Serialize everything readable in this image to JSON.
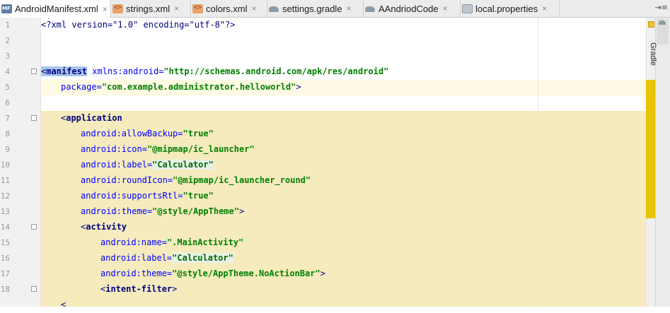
{
  "tabs": [
    {
      "label": "AndroidManifest.xml",
      "icon": "manifest-file-icon",
      "active": true
    },
    {
      "label": "strings.xml",
      "icon": "xml-file-icon"
    },
    {
      "label": "colors.xml",
      "icon": "xml-file-icon"
    },
    {
      "label": "settings.gradle",
      "icon": "gradle-icon"
    },
    {
      "label": "AAndriodCode",
      "icon": "gradle-icon"
    },
    {
      "label": "local.properties",
      "icon": "properties-file-icon"
    }
  ],
  "tab_close_glyph": "×",
  "tab_overflow": "⇥≡",
  "side_panel": {
    "gradle_label": "Gradle"
  },
  "colors": {
    "highlight": "#f5ebbd",
    "current_line": "#fffae3",
    "attr": "#0000ff",
    "value": "#008000",
    "tag": "#000080",
    "marker": "#e9c400"
  },
  "editor": {
    "lines": [
      {
        "n": "1",
        "xml_decl": "<?xml version=\"1.0\" encoding=\"utf-8\"?>"
      },
      {
        "n": "2"
      },
      {
        "n": "3"
      },
      {
        "n": "4",
        "open": "<",
        "tag": "manifest",
        "attr": "xmlns:android",
        "eq": "=",
        "val": "\"http://schemas.android.com/apk/res/android\""
      },
      {
        "n": "5",
        "attr": "package",
        "eq": "=",
        "val": "\"com.example.administrator.helloworld\"",
        "close": ">"
      },
      {
        "n": "6"
      },
      {
        "n": "7",
        "open": "<",
        "tag": "application"
      },
      {
        "n": "8",
        "attr": "android:allowBackup",
        "eq": "=",
        "val": "\"true\""
      },
      {
        "n": "9",
        "attr": "android:icon",
        "eq": "=",
        "val": "\"@mipmap/ic_launcher\""
      },
      {
        "n": "10",
        "attr": "android:label",
        "eq": "=",
        "val": "\"Calculator\""
      },
      {
        "n": "11",
        "attr": "android:roundIcon",
        "eq": "=",
        "val": "\"@mipmap/ic_launcher_round\""
      },
      {
        "n": "12",
        "attr": "android:supportsRtl",
        "eq": "=",
        "val": "\"true\""
      },
      {
        "n": "13",
        "attr": "android:theme",
        "eq": "=",
        "val": "\"@style/AppTheme\"",
        "close": ">"
      },
      {
        "n": "14",
        "open": "<",
        "tag": "activity"
      },
      {
        "n": "15",
        "attr": "android:name",
        "eq": "=",
        "val": "\".MainActivity\""
      },
      {
        "n": "16",
        "attr": "android:label",
        "eq": "=",
        "val": "\"Calculator\""
      },
      {
        "n": "17",
        "attr": "android:theme",
        "eq": "=",
        "val": "\"@style/AppTheme.NoActionBar\"",
        "close": ">"
      },
      {
        "n": "18",
        "open": "<",
        "tag": "intent-filter",
        "close": ">"
      },
      {
        "n": "19",
        "open": "<"
      }
    ]
  }
}
